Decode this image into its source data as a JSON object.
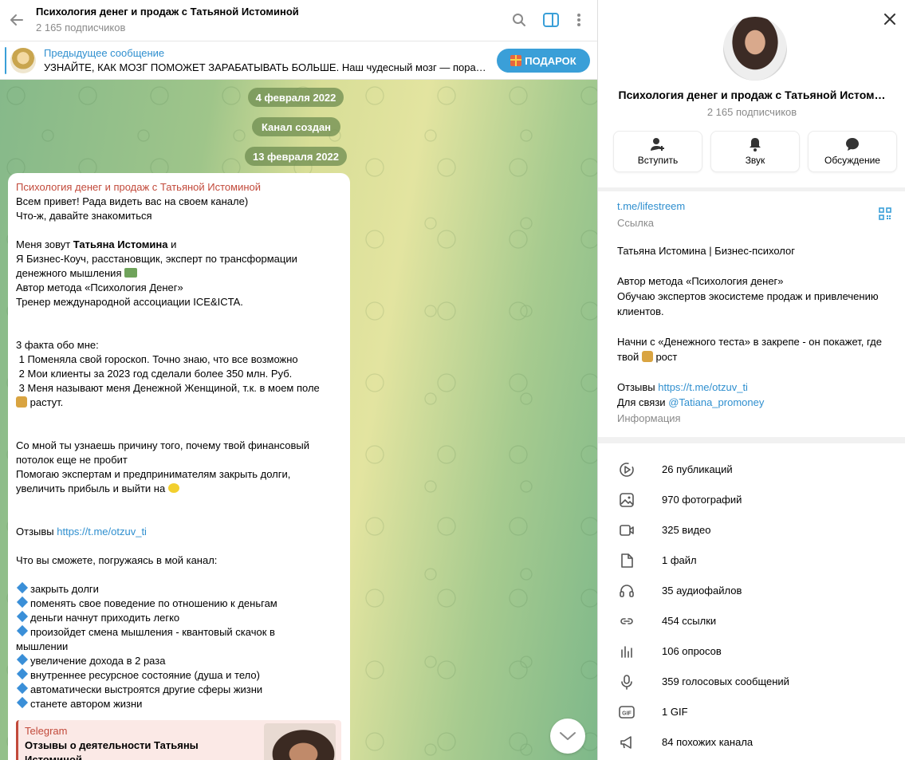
{
  "chat": {
    "title": "Психология денег и продаж с Татьяной Истоминой",
    "subscribers": "2 165 подписчиков"
  },
  "pinned": {
    "title": "Предыдущее сообщение",
    "text": "УЗНАЙТЕ, КАК МОЗГ ПОМОЖЕТ ЗАРАБАТЫВАТЬ БОЛЬШЕ.  Наш чудесный мозг — пораз…",
    "button": "ПОДАРОК"
  },
  "dates": [
    "4 февраля 2022",
    "Канал создан",
    "13 февраля 2022"
  ],
  "message": {
    "author": "Психология денег и продаж с Татьяной Истоминой",
    "l1": "Всем привет! Рада видеть вас на своем канале)",
    "l2": "Что-ж, давайте знакомиться",
    "l3a": "Меня зовут ",
    "l3b": "Татьяна Истомина",
    "l3c": " и",
    "l4": "Я Бизнес-Коуч, расстановщик, эксперт по трансформации",
    "l5": "денежного мышления ",
    "l6": "Автор метода «Психология Денег»",
    "l7": "Тренер международной ассоциации ICE&ICTA.",
    "l8": "3 факта обо мне:",
    "l9": " 1 Поменяла свой гороскоп. Точно знаю, что все возможно",
    "l10": " 2 Мои клиенты за 2023 год сделали более 350 млн. Руб.",
    "l11": " 3 Меня называют меня Денежной Женщиной, т.к. в моем поле",
    "l12": " растут.",
    "l13": "Со мной ты узнаешь причину того, почему твой финансовый",
    "l14": "потолок еще не пробит",
    "l15": "Помогаю экспертам и предпринимателям закрыть долги,",
    "l16": "увеличить прибыль и выйти на ",
    "l17a": "Отзывы ",
    "l17b": "https://t.me/otzuv_ti",
    "l18": "Что вы сможете, погружаясь в мой канал:",
    "bullets": [
      "закрыть долги",
      "поменять свое поведение по отношению к деньгам",
      "деньги начнут приходить легко",
      "произойдет смена мышления - квантовый скачок в",
      "увеличение дохода в 2 раза",
      "внутреннее ресурсное состояние (душа и тело)",
      "автоматически выстроятся другие сферы жизни",
      "станете автором жизни"
    ],
    "bullet4_cont": "мышлении"
  },
  "preview": {
    "site": "Telegram",
    "title": "Отзывы о деятельности Татьяны Истоминой"
  },
  "side": {
    "title": "Психология денег и продаж с Татьяной Истом…",
    "subscribers": "2 165 подписчиков",
    "actions": [
      "Вступить",
      "Звук",
      "Обсуждение"
    ],
    "link": "t.me/lifestreem",
    "link_label": "Ссылка",
    "bio1": "Татьяна Истомина | Бизнес-психолог",
    "bio2": "Автор метода «Психология денег»",
    "bio3": "Обучаю экспертов экосистеме продаж и привлечению",
    "bio4": "клиентов.",
    "bio5": "Начни с «Денежного теста» в закрепе - он покажет, где",
    "bio6a": "твой ",
    "bio6b": " рост",
    "bio7a": "Отзывы ",
    "bio7b": "https://t.me/otzuv_ti",
    "bio8a": "Для связи ",
    "bio8b": "@Tatiana_promoney",
    "info_label": "Информация",
    "stats": [
      {
        "icon": "publications-icon",
        "text": "26 публикаций"
      },
      {
        "icon": "photo-icon",
        "text": "970 фотографий"
      },
      {
        "icon": "video-icon",
        "text": "325 видео"
      },
      {
        "icon": "file-icon",
        "text": "1 файл"
      },
      {
        "icon": "headphones-icon",
        "text": "35 аудиофайлов"
      },
      {
        "icon": "link-icon",
        "text": "454 ссылки"
      },
      {
        "icon": "poll-icon",
        "text": "106 опросов"
      },
      {
        "icon": "microphone-icon",
        "text": "359 голосовых сообщений"
      },
      {
        "icon": "gif-icon",
        "text": "1 GIF"
      },
      {
        "icon": "megaphone-icon",
        "text": "84 похожих канала"
      }
    ]
  },
  "colors": {
    "accent": "#3a9fd8",
    "link": "#2f8fcf",
    "author": "#c24a3b"
  }
}
